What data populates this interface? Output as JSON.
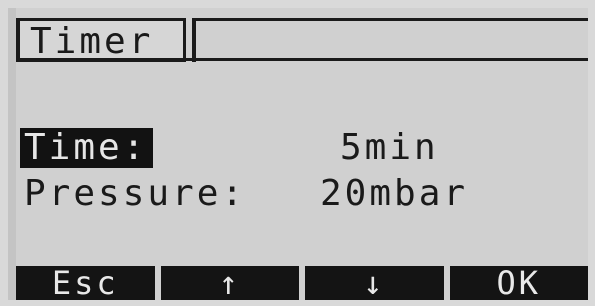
{
  "title": {
    "text": "Timer"
  },
  "rows": [
    {
      "label": "Time:",
      "value": "5min",
      "selected": true
    },
    {
      "label": "Pressure:",
      "value": "20mbar",
      "selected": false
    }
  ],
  "softkeys": [
    {
      "label": "Esc",
      "icon": "escape"
    },
    {
      "label": "↑",
      "icon": "arrow-up-icon"
    },
    {
      "label": "↓",
      "icon": "arrow-down-icon"
    },
    {
      "label": "OK",
      "icon": "confirm"
    }
  ],
  "colors": {
    "screen_background": "#d0d0d0",
    "text": "#1a1a1a",
    "highlight_background": "#121212",
    "highlight_text": "#e6e6e6"
  }
}
